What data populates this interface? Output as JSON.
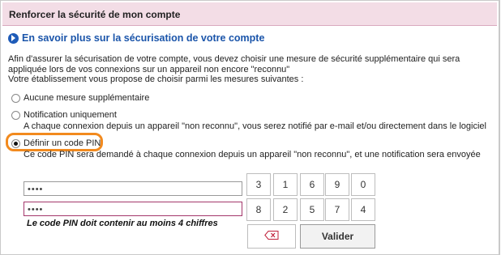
{
  "header": {
    "title": "Renforcer la sécurité de mon compte"
  },
  "info_link": {
    "label": "En savoir plus sur la sécurisation de votre compte",
    "icon": "chevron-right-icon"
  },
  "intro": {
    "line1": "Afin d'assurer la sécurisation de votre compte, vous devez choisir une mesure de sécurité supplémentaire qui sera",
    "line2": "appliquée lors de vos connexions sur un appareil non encore \"reconnu\"",
    "line3": "Votre établissement vous propose de choisir parmi les mesures suivantes :"
  },
  "options": [
    {
      "label": "Aucune mesure supplémentaire",
      "description": "",
      "selected": false
    },
    {
      "label": "Notification uniquement",
      "description": "A chaque connexion depuis un appareil \"non reconnu\", vous serez notifié par e-mail et/ou directement dans le logiciel",
      "selected": false
    },
    {
      "label": "Définir un code PIN",
      "description": "Ce code PIN sera demandé à chaque connexion depuis un appareil \"non reconnu\", et une notification sera envoyée",
      "selected": true
    }
  ],
  "pin": {
    "field1_value": "••••",
    "field2_value": "••••",
    "error": "Le code PIN doit contenir au moins 4 chiffres"
  },
  "keypad": {
    "row1": [
      "3",
      "1",
      "6",
      "9",
      "0"
    ],
    "row2": [
      "8",
      "2",
      "5",
      "7",
      "4"
    ],
    "backspace_icon": "backspace-icon",
    "validate_label": "Valider"
  },
  "colors": {
    "accent": "#1b55aa",
    "header_bg": "#f3dde6",
    "highlight": "#f28a1e",
    "active_border": "#a3376b"
  }
}
